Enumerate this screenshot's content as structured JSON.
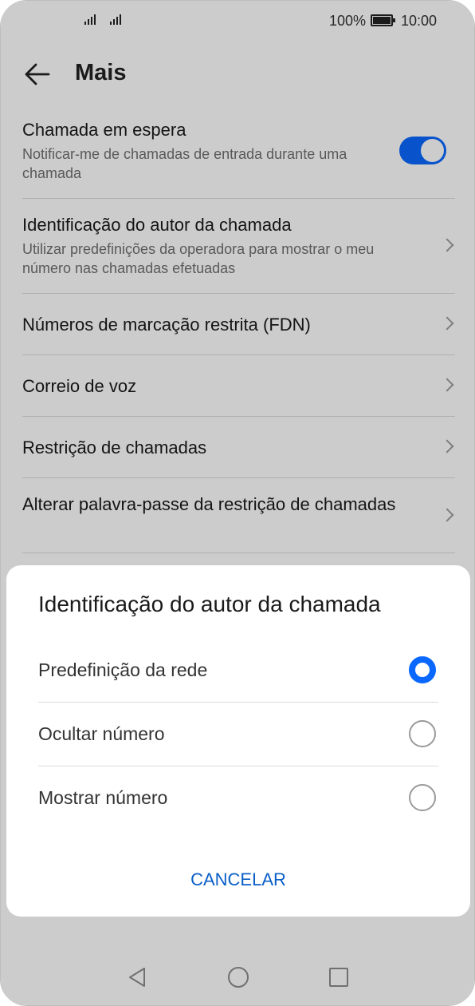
{
  "status_bar": {
    "signal_icons": [
      "signal-icon",
      "signal-icon"
    ],
    "battery_percent": "100%",
    "time": "10:00"
  },
  "header": {
    "back_icon": "arrow-left-icon",
    "title": "Mais"
  },
  "settings": {
    "items": [
      {
        "title": "Chamada em espera",
        "subtitle": "Notificar-me de chamadas de entrada durante uma chamada",
        "control": "toggle",
        "toggle_on": true
      },
      {
        "title": "Identificação do autor da chamada",
        "subtitle": "Utilizar predefinições da operadora para mostrar o meu número nas chamadas efetuadas",
        "control": "chevron"
      },
      {
        "title": "Números de marcação restrita (FDN)",
        "control": "chevron"
      },
      {
        "title": "Correio de voz",
        "control": "chevron"
      },
      {
        "title": "Restrição de chamadas",
        "control": "chevron"
      },
      {
        "title": "Alterar palavra-passe da restrição de chamadas",
        "control": "chevron"
      }
    ]
  },
  "dialog": {
    "title": "Identificação do autor da chamada",
    "options": [
      {
        "label": "Predefinição da rede",
        "selected": true
      },
      {
        "label": "Ocultar número",
        "selected": false
      },
      {
        "label": "Mostrar número",
        "selected": false
      }
    ],
    "cancel_label": "CANCELAR"
  },
  "nav_bar": {
    "icons": [
      "nav-back-icon",
      "nav-home-icon",
      "nav-recent-icon"
    ]
  },
  "colors": {
    "accent": "#0a68ff",
    "cancel_text": "#0a5fc8",
    "overlay": "rgba(0,0,0,0.2)"
  }
}
